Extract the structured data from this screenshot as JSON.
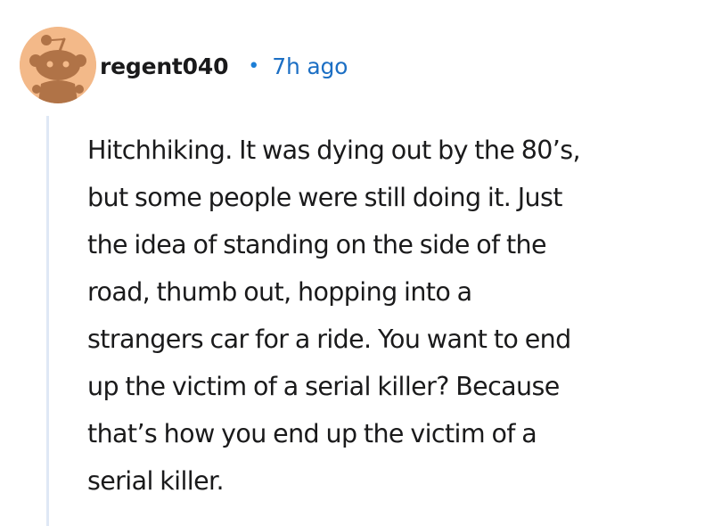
{
  "comment": {
    "author": "regent040",
    "separator": "•",
    "time_ago": "7h ago",
    "body_lines": [
      "Hitchhiking. It was dying out by the 80’s,",
      "but some people were still doing it. Just",
      "the idea of standing on the side of the",
      "road, thumb out, hopping into a",
      "strangers car for a ride. You want to end",
      "up the victim of a serial killer? Because",
      "that’s how you end up the victim of a",
      "serial killer."
    ]
  },
  "avatar": {
    "icon": "reddit-snoo-avatar-icon",
    "background_color": "#f3b989",
    "figure_color": "#b07347"
  },
  "colors": {
    "username": "#1a1a1b",
    "time_link": "#1c6fc4",
    "thread_line": "#dfe8f5"
  }
}
